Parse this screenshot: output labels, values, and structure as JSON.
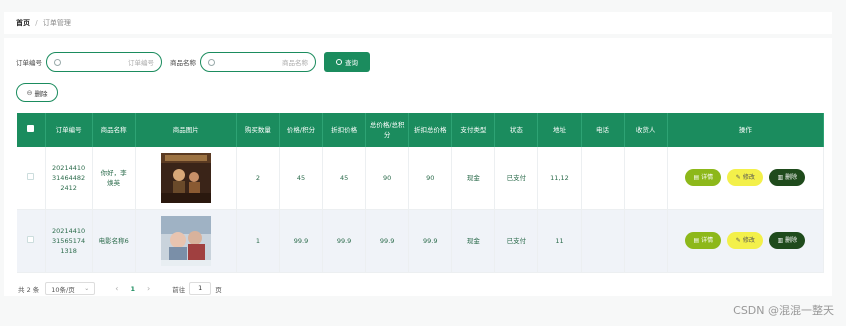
{
  "breadcrumb": {
    "home": "首页",
    "separator": "/",
    "current": "订单管理"
  },
  "search": {
    "order_no_label": "订单编号",
    "order_no_placeholder": "订单编号",
    "product_name_label": "商品名称",
    "product_name_placeholder": "商品名称",
    "query_label": "查询"
  },
  "toolbar": {
    "delete_label": "删除"
  },
  "table": {
    "columns": [
      "订单编号",
      "商品名称",
      "商品图片",
      "购买数量",
      "价格/积分",
      "折扣价格",
      "总价格/总积分",
      "折扣总价格",
      "支付类型",
      "状态",
      "地址",
      "电话",
      "收货人",
      "操作"
    ],
    "rows": [
      {
        "order_no": "202144103146448224 12",
        "order_no_display": [
          "20214410",
          "31464482",
          "2412"
        ],
        "product": [
          "你好，李",
          "焕英"
        ],
        "qty": "2",
        "price": "45",
        "discount_price": "45",
        "total": "90",
        "discount_total": "90",
        "pay_type": "现金",
        "status": "已支付",
        "address": "11,12",
        "phone": "",
        "receiver": ""
      },
      {
        "order_no": "202144103156517413 18",
        "order_no_display": [
          "20214410",
          "31565174",
          "1318"
        ],
        "product": [
          "电影名称6"
        ],
        "qty": "1",
        "price": "99.9",
        "discount_price": "99.9",
        "total": "99.9",
        "discount_total": "99.9",
        "pay_type": "现金",
        "status": "已支付",
        "address": "11",
        "phone": "",
        "receiver": ""
      }
    ],
    "actions": {
      "detail": "详情",
      "edit": "修改",
      "delete": "删除"
    }
  },
  "pagination": {
    "total_text": "共 2 条",
    "page_size": "10条/页",
    "current_page": "1",
    "jump_label": "前往",
    "jump_value": "1",
    "page_unit": "页"
  },
  "watermark": {
    "text": "CSDN @混混一整天"
  },
  "colors": {
    "primary": "#1b8c5e",
    "detail": "#8db81a",
    "edit": "#f3f04a",
    "delete": "#1f4b1c"
  }
}
